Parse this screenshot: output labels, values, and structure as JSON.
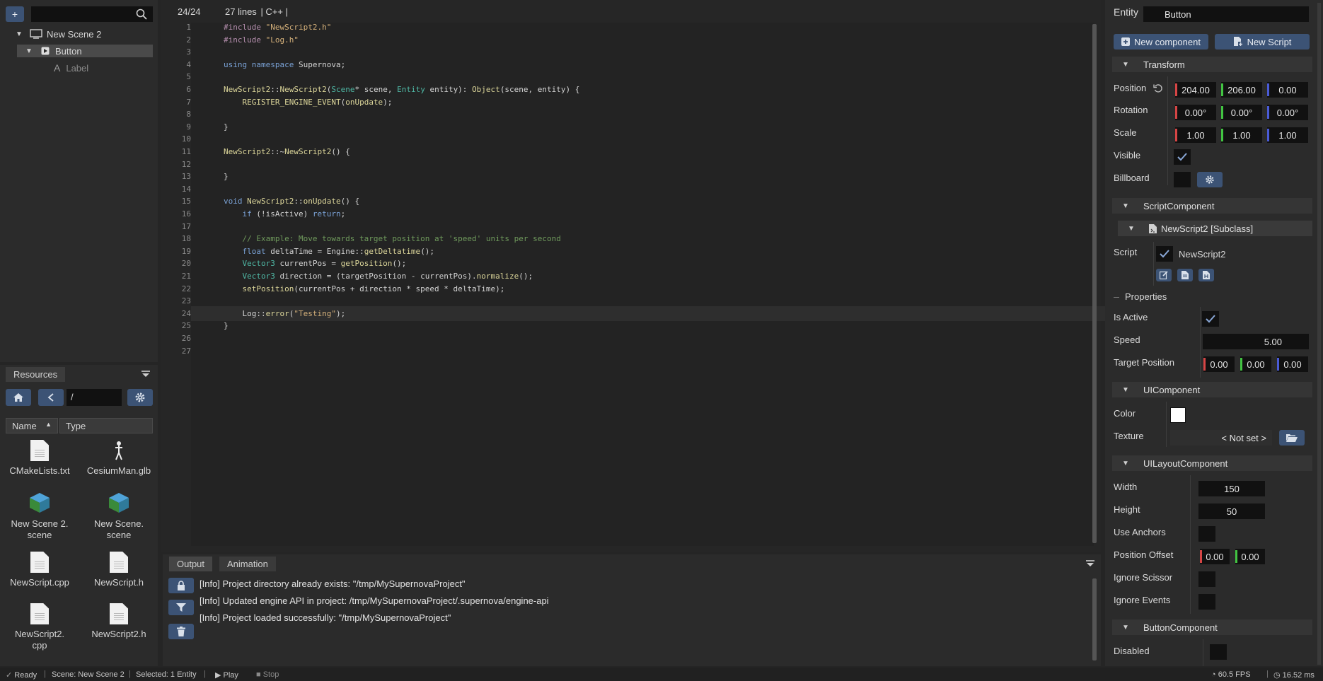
{
  "hierarchy": {
    "add_label": "+",
    "root_label": "New Scene 2",
    "items": [
      {
        "label": "Button"
      },
      {
        "label": "Label"
      }
    ]
  },
  "resources": {
    "tab": "Resources",
    "path": "/",
    "col_name": "Name",
    "col_type": "Type",
    "files": [
      "CMakeLists.txt",
      "CesiumMan.glb",
      "New Scene 2.\nscene",
      "New Scene.\nscene",
      "NewScript.cpp",
      "NewScript.h",
      "NewScript2.\ncpp",
      "NewScript2.h"
    ]
  },
  "editor": {
    "cursor": "24/24",
    "lines": "27 lines",
    "lang": "| C++ |"
  },
  "code": [
    "#include \"NewScript2.h\"",
    "#include \"Log.h\"",
    "",
    "using namespace Supernova;",
    "",
    "NewScript2::NewScript2(Scene* scene, Entity entity): Object(scene, entity) {",
    "    REGISTER_ENGINE_EVENT(onUpdate);",
    "",
    "}",
    "",
    "NewScript2::~NewScript2() {",
    "",
    "}",
    "",
    "void NewScript2::onUpdate() {",
    "    if (!isActive) return;",
    "",
    "    // Example: Move towards target position at 'speed' units per second",
    "    float deltaTime = Engine::getDeltatime();",
    "    Vector3 currentPos = getPosition();",
    "    Vector3 direction = (targetPosition - currentPos).normalize();",
    "    setPosition(currentPos + direction * speed * deltaTime);",
    "",
    "    Log::error(\"Testing\");",
    "}",
    "",
    ""
  ],
  "output": {
    "tabs": [
      "Output",
      "Animation"
    ],
    "logs": [
      "[Info] Project directory already exists: \"/tmp/MySupernovaProject\"",
      "[Info] Updated engine API in project: /tmp/MySupernovaProject/.supernova/engine-api",
      "[Info] Project loaded successfully: \"/tmp/MySupernovaProject\""
    ]
  },
  "inspector": {
    "entity_label": "Entity",
    "entity_value": "Button",
    "new_component": "New component",
    "new_script": "New Script",
    "transform": {
      "title": "Transform",
      "position": "Position",
      "rotation": "Rotation",
      "scale": "Scale",
      "visible": "Visible",
      "billboard": "Billboard",
      "pos": [
        "204.00",
        "206.00",
        "0.00"
      ],
      "rot": [
        "0.00°",
        "0.00°",
        "0.00°"
      ],
      "scl": [
        "1.00",
        "1.00",
        "1.00"
      ]
    },
    "script": {
      "title": "ScriptComponent",
      "subclass": "NewScript2 [Subclass]",
      "label": "Script",
      "name": "NewScript2",
      "properties": "Properties",
      "is_active": "Is Active",
      "speed": "Speed",
      "speed_value": "5.00",
      "target_position": "Target Position",
      "target": [
        "0.00",
        "0.00",
        "0.00"
      ]
    },
    "ui": {
      "title": "UIComponent",
      "color": "Color",
      "texture": "Texture",
      "texture_value": "< Not set >"
    },
    "layout": {
      "title": "UILayoutComponent",
      "width": "Width",
      "width_value": "150",
      "height": "Height",
      "height_value": "50",
      "use_anchors": "Use Anchors",
      "position_offset": "Position Offset",
      "offset": [
        "0.00",
        "0.00"
      ],
      "ignore_scissor": "Ignore Scissor",
      "ignore_events": "Ignore Events"
    },
    "button": {
      "title": "ButtonComponent",
      "disabled": "Disabled"
    }
  },
  "status": {
    "ready": "Ready",
    "scene": "Scene: New Scene 2",
    "selected": "Selected: 1 Entity",
    "play": "Play",
    "stop": "Stop",
    "fps": "60.5 FPS",
    "ms": "16.52 ms"
  }
}
